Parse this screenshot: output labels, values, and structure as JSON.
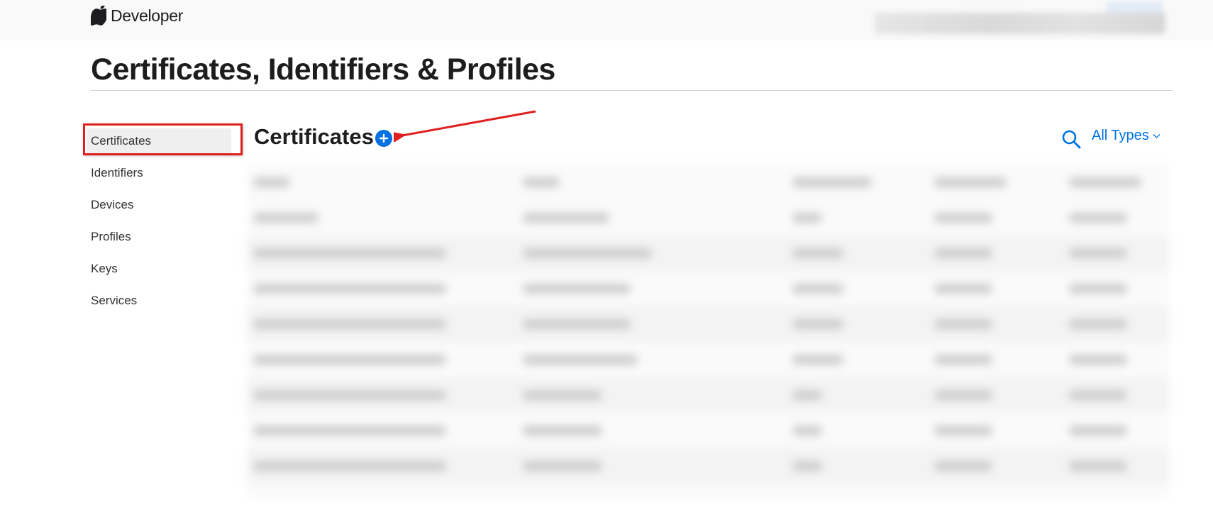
{
  "nav": {
    "brand": "Developer",
    "apple_icon": "apple-logo-icon"
  },
  "page": {
    "title": "Certificates, Identifiers & Profiles"
  },
  "sidebar": {
    "items": [
      {
        "label": "Certificates",
        "active": true
      },
      {
        "label": "Identifiers",
        "active": false
      },
      {
        "label": "Devices",
        "active": false
      },
      {
        "label": "Profiles",
        "active": false
      },
      {
        "label": "Keys",
        "active": false
      },
      {
        "label": "Services",
        "active": false
      }
    ]
  },
  "main": {
    "section_title": "Certificates",
    "add_icon": "plus-circle-icon",
    "search_icon": "search-icon",
    "filter_label": "All Types",
    "filter_icon": "chevron-down-icon"
  },
  "colors": {
    "accent": "#0071e3",
    "annotation": "#e02020"
  }
}
